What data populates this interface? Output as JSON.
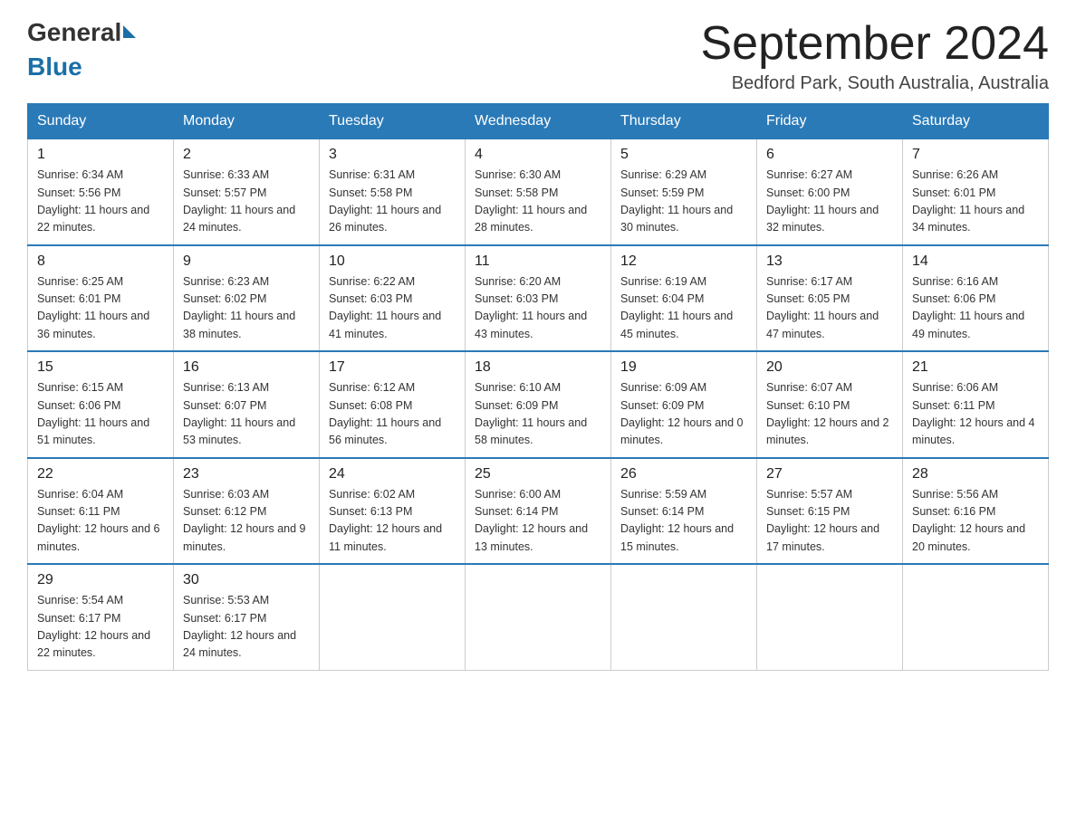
{
  "header": {
    "logo_general": "General",
    "logo_blue": "Blue",
    "month_title": "September 2024",
    "location": "Bedford Park, South Australia, Australia"
  },
  "days_of_week": [
    "Sunday",
    "Monday",
    "Tuesday",
    "Wednesday",
    "Thursday",
    "Friday",
    "Saturday"
  ],
  "weeks": [
    [
      {
        "day": "1",
        "sunrise": "6:34 AM",
        "sunset": "5:56 PM",
        "daylight": "11 hours and 22 minutes."
      },
      {
        "day": "2",
        "sunrise": "6:33 AM",
        "sunset": "5:57 PM",
        "daylight": "11 hours and 24 minutes."
      },
      {
        "day": "3",
        "sunrise": "6:31 AM",
        "sunset": "5:58 PM",
        "daylight": "11 hours and 26 minutes."
      },
      {
        "day": "4",
        "sunrise": "6:30 AM",
        "sunset": "5:58 PM",
        "daylight": "11 hours and 28 minutes."
      },
      {
        "day": "5",
        "sunrise": "6:29 AM",
        "sunset": "5:59 PM",
        "daylight": "11 hours and 30 minutes."
      },
      {
        "day": "6",
        "sunrise": "6:27 AM",
        "sunset": "6:00 PM",
        "daylight": "11 hours and 32 minutes."
      },
      {
        "day": "7",
        "sunrise": "6:26 AM",
        "sunset": "6:01 PM",
        "daylight": "11 hours and 34 minutes."
      }
    ],
    [
      {
        "day": "8",
        "sunrise": "6:25 AM",
        "sunset": "6:01 PM",
        "daylight": "11 hours and 36 minutes."
      },
      {
        "day": "9",
        "sunrise": "6:23 AM",
        "sunset": "6:02 PM",
        "daylight": "11 hours and 38 minutes."
      },
      {
        "day": "10",
        "sunrise": "6:22 AM",
        "sunset": "6:03 PM",
        "daylight": "11 hours and 41 minutes."
      },
      {
        "day": "11",
        "sunrise": "6:20 AM",
        "sunset": "6:03 PM",
        "daylight": "11 hours and 43 minutes."
      },
      {
        "day": "12",
        "sunrise": "6:19 AM",
        "sunset": "6:04 PM",
        "daylight": "11 hours and 45 minutes."
      },
      {
        "day": "13",
        "sunrise": "6:17 AM",
        "sunset": "6:05 PM",
        "daylight": "11 hours and 47 minutes."
      },
      {
        "day": "14",
        "sunrise": "6:16 AM",
        "sunset": "6:06 PM",
        "daylight": "11 hours and 49 minutes."
      }
    ],
    [
      {
        "day": "15",
        "sunrise": "6:15 AM",
        "sunset": "6:06 PM",
        "daylight": "11 hours and 51 minutes."
      },
      {
        "day": "16",
        "sunrise": "6:13 AM",
        "sunset": "6:07 PM",
        "daylight": "11 hours and 53 minutes."
      },
      {
        "day": "17",
        "sunrise": "6:12 AM",
        "sunset": "6:08 PM",
        "daylight": "11 hours and 56 minutes."
      },
      {
        "day": "18",
        "sunrise": "6:10 AM",
        "sunset": "6:09 PM",
        "daylight": "11 hours and 58 minutes."
      },
      {
        "day": "19",
        "sunrise": "6:09 AM",
        "sunset": "6:09 PM",
        "daylight": "12 hours and 0 minutes."
      },
      {
        "day": "20",
        "sunrise": "6:07 AM",
        "sunset": "6:10 PM",
        "daylight": "12 hours and 2 minutes."
      },
      {
        "day": "21",
        "sunrise": "6:06 AM",
        "sunset": "6:11 PM",
        "daylight": "12 hours and 4 minutes."
      }
    ],
    [
      {
        "day": "22",
        "sunrise": "6:04 AM",
        "sunset": "6:11 PM",
        "daylight": "12 hours and 6 minutes."
      },
      {
        "day": "23",
        "sunrise": "6:03 AM",
        "sunset": "6:12 PM",
        "daylight": "12 hours and 9 minutes."
      },
      {
        "day": "24",
        "sunrise": "6:02 AM",
        "sunset": "6:13 PM",
        "daylight": "12 hours and 11 minutes."
      },
      {
        "day": "25",
        "sunrise": "6:00 AM",
        "sunset": "6:14 PM",
        "daylight": "12 hours and 13 minutes."
      },
      {
        "day": "26",
        "sunrise": "5:59 AM",
        "sunset": "6:14 PM",
        "daylight": "12 hours and 15 minutes."
      },
      {
        "day": "27",
        "sunrise": "5:57 AM",
        "sunset": "6:15 PM",
        "daylight": "12 hours and 17 minutes."
      },
      {
        "day": "28",
        "sunrise": "5:56 AM",
        "sunset": "6:16 PM",
        "daylight": "12 hours and 20 minutes."
      }
    ],
    [
      {
        "day": "29",
        "sunrise": "5:54 AM",
        "sunset": "6:17 PM",
        "daylight": "12 hours and 22 minutes."
      },
      {
        "day": "30",
        "sunrise": "5:53 AM",
        "sunset": "6:17 PM",
        "daylight": "12 hours and 24 minutes."
      },
      null,
      null,
      null,
      null,
      null
    ]
  ]
}
